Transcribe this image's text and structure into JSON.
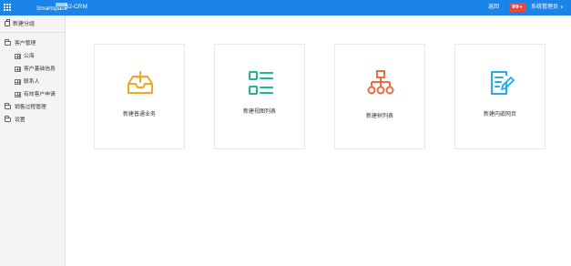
{
  "topbar": {
    "logo_text": "Smartspace",
    "app_title": "S2-CRM",
    "back_label": "返回",
    "badge_count": "99+",
    "user_label": "系统管理员",
    "accent_color": "#1a84e8"
  },
  "sidebar": {
    "header": "新建分组",
    "items": [
      {
        "label": "客户管理",
        "icon": "folder-icon"
      },
      {
        "label": "公海",
        "icon": "table-icon"
      },
      {
        "label": "客户基础信息",
        "icon": "table-icon"
      },
      {
        "label": "联系人",
        "icon": "table-icon"
      },
      {
        "label": "有效客户申请",
        "icon": "table-icon"
      },
      {
        "label": "销售过程管理",
        "icon": "folder-icon"
      },
      {
        "label": "设置",
        "icon": "folder-icon"
      }
    ]
  },
  "cards": [
    {
      "label": "新建普通业务",
      "icon": "inbox-plus-icon",
      "color": "#f5a623"
    },
    {
      "label": "新建视图列表",
      "icon": "list-view-icon",
      "color": "#1fb58f"
    },
    {
      "label": "新建树列表",
      "icon": "tree-structure-icon",
      "color": "#f26a3d"
    },
    {
      "label": "新建内嵌网页",
      "icon": "edit-document-icon",
      "color": "#29a9e8"
    }
  ]
}
